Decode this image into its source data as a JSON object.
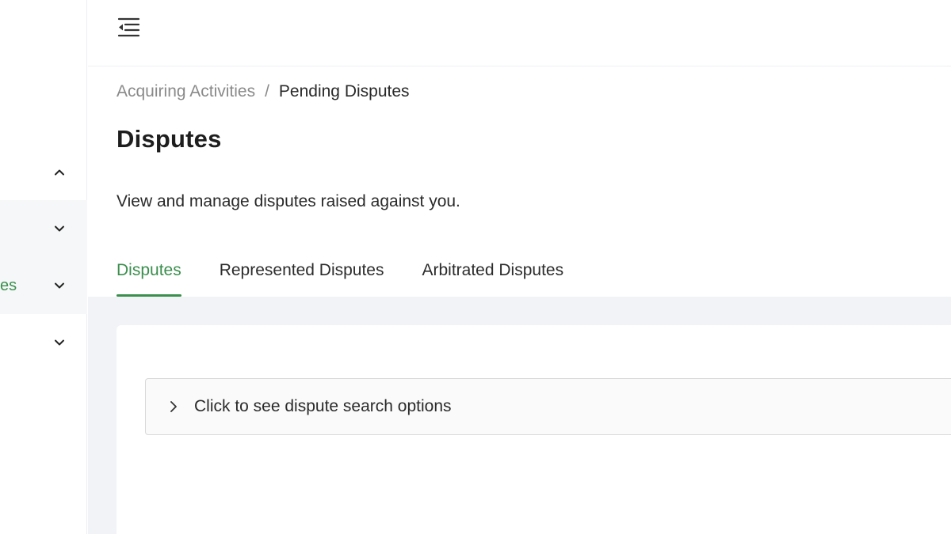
{
  "sidebar": {
    "items": [
      {
        "label": "",
        "chevron": "chevron-up-icon"
      },
      {
        "label": "",
        "chevron": "chevron-down-icon"
      },
      {
        "label": "es",
        "chevron": "chevron-down-icon"
      },
      {
        "label": "",
        "chevron": "chevron-down-icon"
      }
    ]
  },
  "topbar": {
    "menu_icon": "collapse-menu-icon"
  },
  "breadcrumb": {
    "parent": "Acquiring Activities",
    "separator": "/",
    "current": "Pending Disputes"
  },
  "page": {
    "title": "Disputes",
    "description": "View and manage disputes raised against you."
  },
  "tabs": [
    {
      "label": "Disputes",
      "active": true
    },
    {
      "label": "Represented Disputes",
      "active": false
    },
    {
      "label": "Arbitrated Disputes",
      "active": false
    }
  ],
  "search": {
    "toggle_label": "Click to see dispute search options",
    "icon": "chevron-right-icon"
  },
  "colors": {
    "accent": "#3a8f4d",
    "content_bg": "#f1f3f6"
  }
}
